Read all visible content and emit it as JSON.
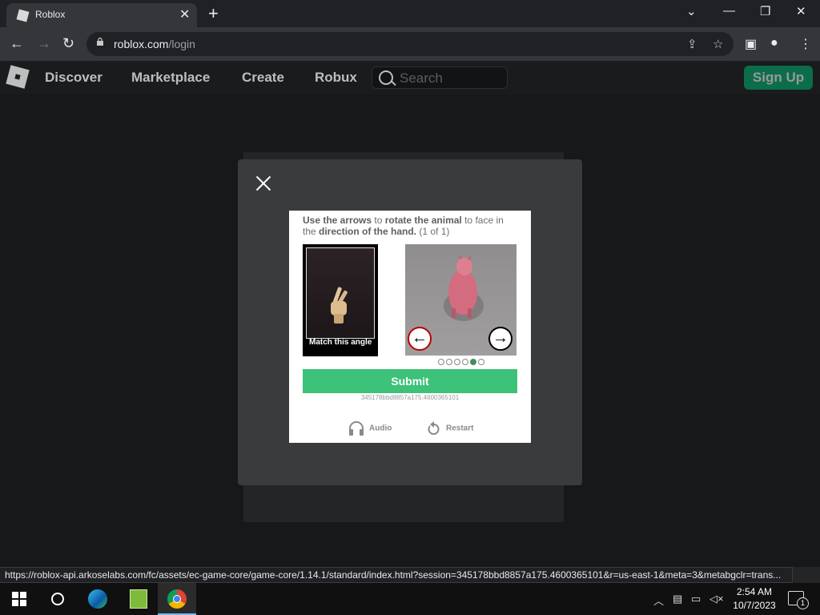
{
  "browser": {
    "tab_title": "Roblox",
    "url_host": "roblox.com",
    "url_path": "/login",
    "status_url": "https://roblox-api.arkoselabs.com/fc/assets/ec-game-core/game-core/1.14.1/standard/index.html?session=345178bbd8857a175.4600365101&r=us-east-1&meta=3&metabgclr=trans..."
  },
  "header": {
    "nav": [
      "Discover",
      "Marketplace",
      "Create",
      "Robux"
    ],
    "search_placeholder": "Search",
    "signup_label": "Sign Up"
  },
  "captcha": {
    "instruction_parts": [
      "Use the arrows",
      " to ",
      "rotate the animal",
      " to face in the ",
      "direction of the hand.",
      " (1 of 1)"
    ],
    "match_label": "Match this angle",
    "submit_label": "Submit",
    "session_id": "345178bbd8857a175.4600365101",
    "audio_label": "Audio",
    "restart_label": "Restart",
    "progress": {
      "total": 6,
      "current": 5
    },
    "left_arrow_glyph": "←",
    "right_arrow_glyph": "→"
  },
  "taskbar": {
    "time": "2:54 AM",
    "date": "10/7/2023",
    "notification_count": "1"
  },
  "colors": {
    "submit": "#3ec178",
    "signup": "#00b06f",
    "modal": "#393b3d"
  }
}
